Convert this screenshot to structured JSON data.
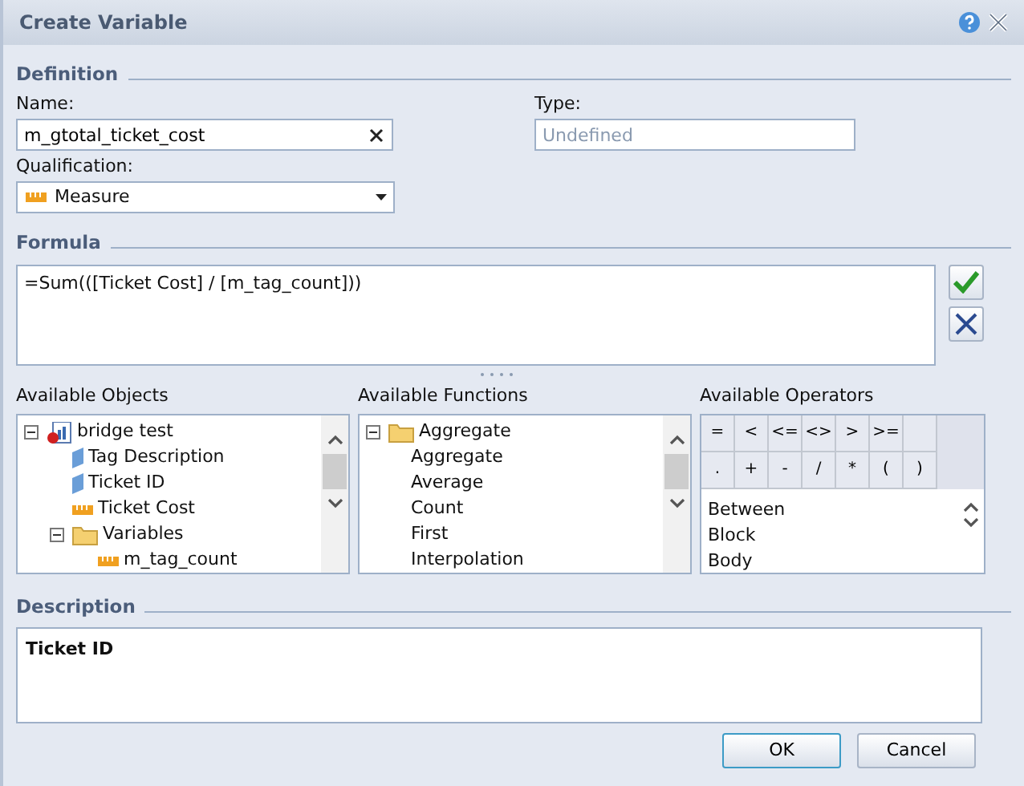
{
  "window": {
    "title": "Create Variable"
  },
  "definition": {
    "heading": "Definition",
    "name_label": "Name:",
    "name_value": "m_gtotal_ticket_cost",
    "type_label": "Type:",
    "type_placeholder": "Undefined",
    "qualification_label": "Qualification:",
    "qualification_value": "Measure"
  },
  "formula": {
    "heading": "Formula",
    "value": "=Sum(([Ticket Cost] / [m_tag_count]))"
  },
  "available_objects": {
    "label": "Available Objects",
    "items": [
      {
        "label": "bridge test",
        "kind": "report",
        "expanded": true,
        "children": [
          {
            "label": "Tag Description",
            "kind": "dimension"
          },
          {
            "label": "Ticket ID",
            "kind": "dimension"
          },
          {
            "label": "Ticket Cost",
            "kind": "measure"
          },
          {
            "label": "Variables",
            "kind": "folder",
            "expanded": true,
            "children": [
              {
                "label": "m_tag_count",
                "kind": "measure"
              }
            ]
          }
        ]
      }
    ]
  },
  "available_functions": {
    "label": "Available Functions",
    "items": [
      {
        "label": "Aggregate",
        "kind": "folder",
        "expanded": true,
        "children": [
          {
            "label": "Aggregate"
          },
          {
            "label": "Average"
          },
          {
            "label": "Count"
          },
          {
            "label": "First"
          },
          {
            "label": "Interpolation"
          }
        ]
      }
    ]
  },
  "available_operators": {
    "label": "Available Operators",
    "operators": [
      [
        "=",
        "<",
        "<=",
        "<>",
        ">",
        ">="
      ],
      [
        ".",
        "+",
        "-",
        "/",
        "*",
        "(",
        ")"
      ]
    ],
    "items": [
      "Between",
      "Block",
      "Body"
    ]
  },
  "description": {
    "heading": "Description",
    "value": "Ticket ID"
  },
  "buttons": [
    {
      "label": "OK",
      "default": true
    },
    {
      "label": "Cancel",
      "default": false
    }
  ]
}
